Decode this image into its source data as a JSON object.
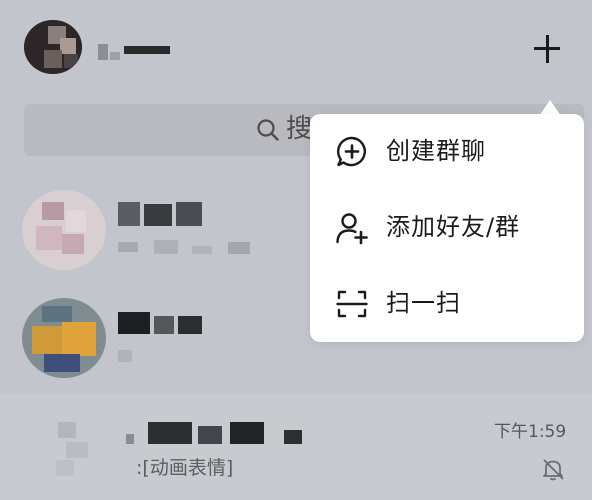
{
  "header": {
    "add_icon": "plus-icon"
  },
  "search": {
    "label": "搜",
    "icon": "search-icon"
  },
  "chats": [
    {
      "time": "",
      "preview": ""
    },
    {
      "time": "",
      "preview": ""
    },
    {
      "time": "下午1:59",
      "preview": ":[动画表情]",
      "muted_icon": "bell-off-icon"
    }
  ],
  "menu": {
    "items": [
      {
        "label": "创建群聊",
        "icon": "chat-plus-icon"
      },
      {
        "label": "添加好友/群",
        "icon": "add-user-icon"
      },
      {
        "label": "扫一扫",
        "icon": "scan-icon"
      }
    ]
  }
}
